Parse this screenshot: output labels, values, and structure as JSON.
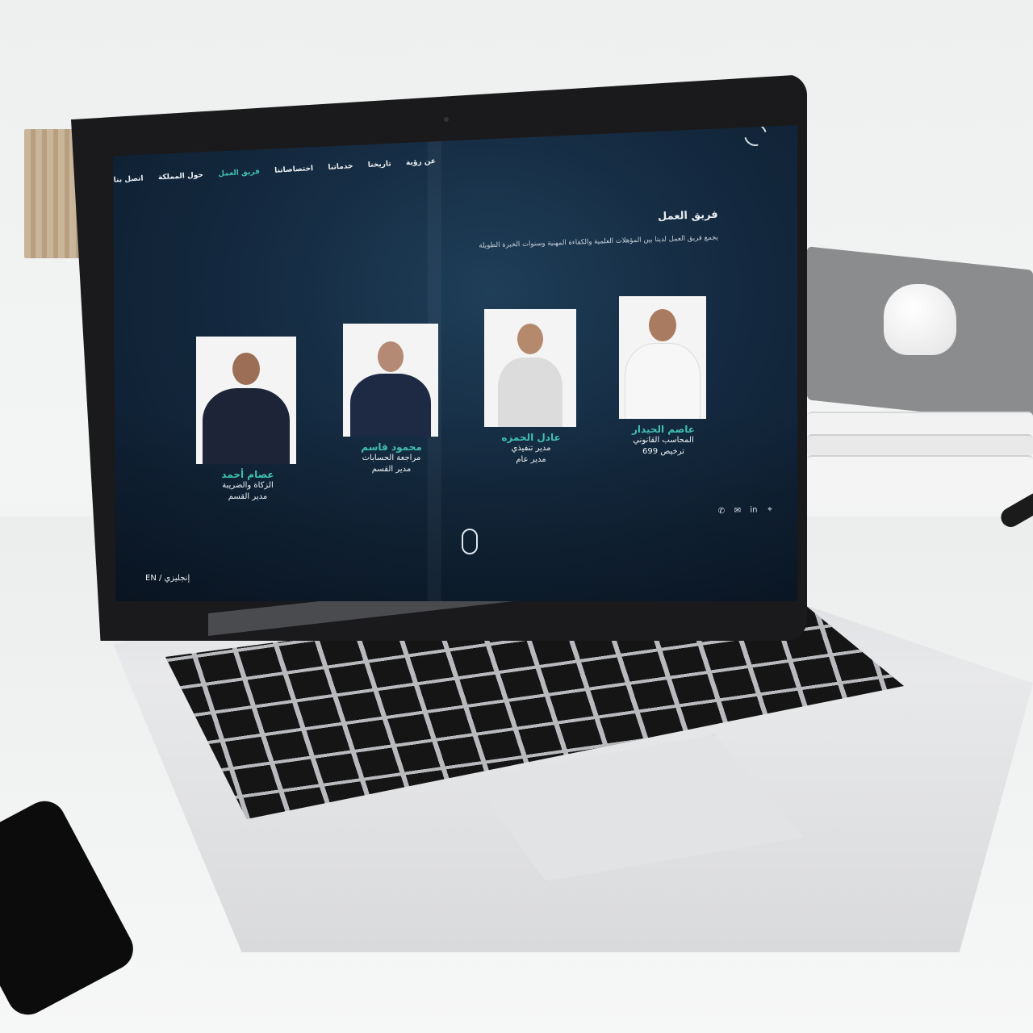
{
  "nav": {
    "items": [
      {
        "label": "عن رؤية"
      },
      {
        "label": "تاريخنا"
      },
      {
        "label": "خدماتنا"
      },
      {
        "label": "اختصاصاتنا"
      },
      {
        "label": "فريق العمل"
      },
      {
        "label": "حول المملكة"
      },
      {
        "label": "اتصل بنا"
      }
    ],
    "active": "فريق العمل"
  },
  "section": {
    "title": "فريق العمل",
    "description": "يجمع فريق العمل لدينا بين المؤهلات العلمية والكفاءة المهنية وسنوات الخبرة الطويلة"
  },
  "team": [
    {
      "name": "عاصم الحيدار",
      "role1": "المحاسب القانوني",
      "role2": "ترخيص 699"
    },
    {
      "name": "عادل الحمزه",
      "role1": "مدير تنفيذي",
      "role2": "مدير عام"
    },
    {
      "name": "محمود قاسم",
      "role1": "مراجعة الحسابات",
      "role2": "مدير القسم"
    },
    {
      "name": "عصام أحمد",
      "role1": "الزكاة والضريبة",
      "role2": "مدير القسم"
    }
  ],
  "language": {
    "label": "EN / إنجليزي"
  },
  "icons": [
    "location-icon",
    "linkedin-icon",
    "email-icon",
    "whatsapp-icon"
  ],
  "colors": {
    "accent": "#3fc0b0",
    "background": "#142a40"
  }
}
